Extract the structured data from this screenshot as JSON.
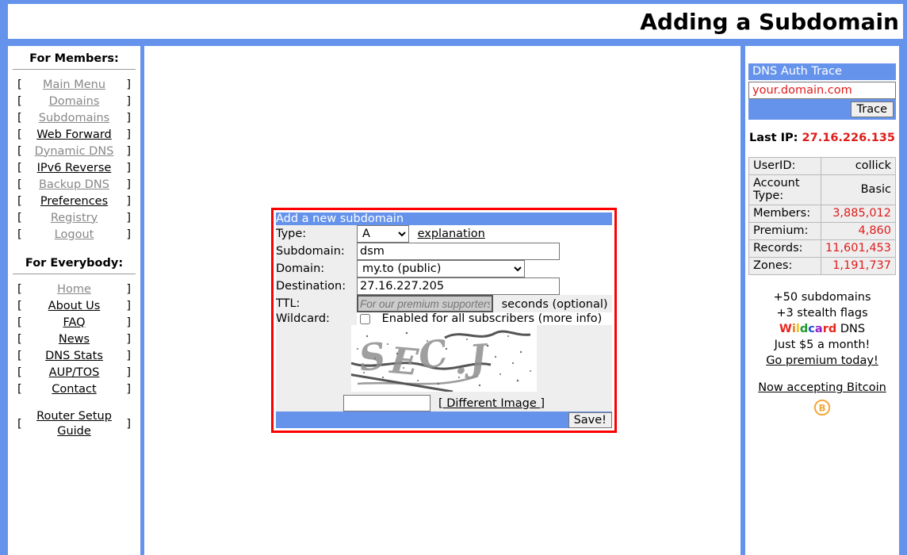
{
  "header": {
    "title": "Adding a Subdomain"
  },
  "sidebar_left": {
    "members_heading": "For Members:",
    "everybody_heading": "For Everybody:",
    "bracket_open": "[",
    "bracket_close": "]",
    "members_items": [
      {
        "label": "Main Menu",
        "state": "dim"
      },
      {
        "label": "Domains",
        "state": "dim"
      },
      {
        "label": "Subdomains",
        "state": "dim"
      },
      {
        "label": "Web Forward",
        "state": "on"
      },
      {
        "label": "Dynamic DNS",
        "state": "dim"
      },
      {
        "label": "IPv6 Reverse",
        "state": "on"
      },
      {
        "label": "Backup DNS",
        "state": "dim"
      },
      {
        "label": "Preferences",
        "state": "on"
      },
      {
        "label": "Registry",
        "state": "dim"
      },
      {
        "label": "Logout",
        "state": "dim"
      }
    ],
    "everybody_items": [
      {
        "label": "Home",
        "state": "dim"
      },
      {
        "label": "About Us",
        "state": "on"
      },
      {
        "label": "FAQ",
        "state": "on"
      },
      {
        "label": "News",
        "state": "on"
      },
      {
        "label": "DNS Stats",
        "state": "on"
      },
      {
        "label": "AUP/TOS",
        "state": "on"
      },
      {
        "label": "Contact",
        "state": "on"
      }
    ],
    "router_item": {
      "line1": "Router Setup",
      "line2": "Guide"
    }
  },
  "form": {
    "title": "Add a new subdomain",
    "type_label": "Type:",
    "type_value": "A",
    "type_options": [
      "A"
    ],
    "explanation_link": "explanation",
    "subdomain_label": "Subdomain:",
    "subdomain_value": "dsm",
    "domain_label": "Domain:",
    "domain_value": "my.to (public)",
    "domain_options": [
      "my.to (public)"
    ],
    "destination_label": "Destination:",
    "destination_value": "27.16.227.205",
    "ttl_label": "TTL:",
    "ttl_placeholder": "For our premium supporters",
    "ttl_value": "",
    "ttl_unit": "seconds (optional)",
    "wildcard_label": "Wildcard:",
    "wildcard_checked": false,
    "wildcard_text": "Enabled for all subscribers (",
    "wildcard_link": "more info",
    "wildcard_text_end": ")",
    "captcha_value": "",
    "different_image_link": "[ Different Image ]",
    "save_label": "Save!"
  },
  "sidebar_right": {
    "panel_title": "DNS Auth Trace",
    "trace_input_value": "your.domain.com",
    "trace_button": "Trace",
    "last_ip_label": "Last IP:",
    "last_ip_value": "27.16.226.135",
    "stats": [
      {
        "key": "UserID:",
        "value": "collick",
        "red": false
      },
      {
        "key": "Account Type:",
        "value": "Basic",
        "red": false
      },
      {
        "key": "Members:",
        "value": "3,885,012",
        "red": true
      },
      {
        "key": "Premium:",
        "value": "4,860",
        "red": true
      },
      {
        "key": "Records:",
        "value": "11,601,453",
        "red": true
      },
      {
        "key": "Zones:",
        "value": "1,191,737",
        "red": true
      }
    ],
    "promo": {
      "line1": "+50 subdomains",
      "line2": "+3 stealth flags",
      "wildcard_word": "Wildcard",
      "wildcard_suffix": " DNS",
      "line4": "Just $5 a month!",
      "go_premium_link": "Go premium today!",
      "bitcoin_link": "Now accepting Bitcoin",
      "bitcoin_icon": "bitcoin-icon"
    }
  },
  "colors": {
    "page_blue": "#6593ec",
    "form_border_red": "#fe0000",
    "stat_red": "#e01b1b",
    "label_gray": "#eeeeee",
    "bitcoin_orange": "#f2a93b"
  }
}
